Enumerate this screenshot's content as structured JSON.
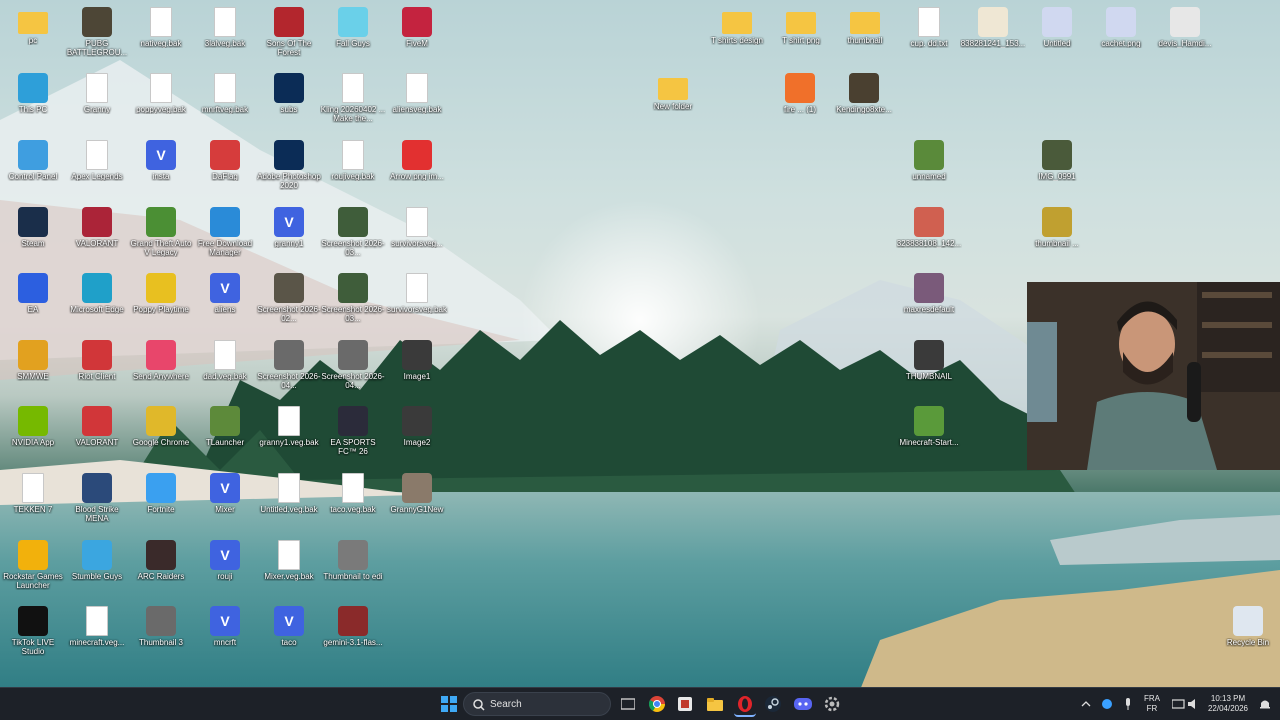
{
  "desktop": {
    "icons": [
      {
        "label": "pc",
        "kind": "folder",
        "color": "#f5c542"
      },
      {
        "label": "PUBG BATTLEGROU...",
        "kind": "app",
        "color": "#4d4636"
      },
      {
        "label": "nativeg.bak",
        "kind": "doc",
        "color": "#ffffff"
      },
      {
        "label": "3lalveg.bak",
        "kind": "doc",
        "color": "#ffffff"
      },
      {
        "label": "Sons Of The Forest",
        "kind": "app",
        "color": "#b3262d"
      },
      {
        "label": "Fall Guys",
        "kind": "app",
        "color": "#6ad0e9"
      },
      {
        "label": "FiveM",
        "kind": "app",
        "color": "#c4233f"
      },
      {
        "label": "This PC",
        "kind": "app",
        "color": "#2e9fd9"
      },
      {
        "label": "Granny",
        "kind": "doc",
        "color": "#ffffff"
      },
      {
        "label": "poppyveg.bak",
        "kind": "doc",
        "color": "#ffffff"
      },
      {
        "label": "mnrftveg.bak",
        "kind": "doc",
        "color": "#ffffff"
      },
      {
        "label": "subs",
        "kind": "app",
        "color": "#0b2c56"
      },
      {
        "label": "Kling 20260402 ... Make the...",
        "kind": "doc",
        "color": "#ffffff"
      },
      {
        "label": "aliensveg.bak",
        "kind": "doc",
        "color": "#ffffff"
      },
      {
        "label": "Control Panel",
        "kind": "app",
        "color": "#3f9ee0"
      },
      {
        "label": "Apex Legends",
        "kind": "doc",
        "color": "#ffffff"
      },
      {
        "label": "insta",
        "kind": "vveg",
        "color": "#3f63e0"
      },
      {
        "label": "DaFlag",
        "kind": "app",
        "color": "#d63c3c"
      },
      {
        "label": "Adobe Photoshop 2020",
        "kind": "app",
        "color": "#0b2c56"
      },
      {
        "label": "roujiveg.bak",
        "kind": "doc",
        "color": "#ffffff"
      },
      {
        "label": "Arrow png im...",
        "kind": "app",
        "color": "#e23030"
      },
      {
        "label": "Steam",
        "kind": "app",
        "color": "#1a2e4a"
      },
      {
        "label": "VALORANT",
        "kind": "app",
        "color": "#ab2438"
      },
      {
        "label": "Grand Theft Auto V Legacy",
        "kind": "app",
        "color": "#4b8f34"
      },
      {
        "label": "Free Download Manager",
        "kind": "app",
        "color": "#2a8bd8"
      },
      {
        "label": "granny1",
        "kind": "vveg",
        "color": "#3f63e0"
      },
      {
        "label": "Screenshot 2026-03...",
        "kind": "app",
        "color": "#3f5d3a"
      },
      {
        "label": "survivorsveg...",
        "kind": "doc",
        "color": "#ffffff"
      },
      {
        "label": "EA",
        "kind": "app",
        "color": "#2c5fe0"
      },
      {
        "label": "Microsoft Edge",
        "kind": "app",
        "color": "#1fa0c9"
      },
      {
        "label": "Poppy Playtime",
        "kind": "app",
        "color": "#e8c020"
      },
      {
        "label": "aliens",
        "kind": "vveg",
        "color": "#3f63e0"
      },
      {
        "label": "Screenshot 2026-02...",
        "kind": "app",
        "color": "#5a5548"
      },
      {
        "label": "Screenshot 2026-03...",
        "kind": "app",
        "color": "#3f5d3a"
      },
      {
        "label": "survivorsveg.bak",
        "kind": "doc",
        "color": "#ffffff"
      },
      {
        "label": "SMMWE",
        "kind": "app",
        "color": "#e2a11f"
      },
      {
        "label": "Riot Client",
        "kind": "app",
        "color": "#d13639"
      },
      {
        "label": "Send Anywhere",
        "kind": "app",
        "color": "#e8466b"
      },
      {
        "label": "dad.veg.bak",
        "kind": "doc",
        "color": "#ffffff"
      },
      {
        "label": "Screenshot 2026-04...",
        "kind": "app",
        "color": "#6a6a6a"
      },
      {
        "label": "Screenshot 2026-04...",
        "kind": "app",
        "color": "#6a6a6a"
      },
      {
        "label": "Image1",
        "kind": "app",
        "color": "#3a3a3a"
      },
      {
        "label": "NVIDIA App",
        "kind": "app",
        "color": "#76b900"
      },
      {
        "label": "VALORANT",
        "kind": "app",
        "color": "#d13639"
      },
      {
        "label": "Google Chrome",
        "kind": "app",
        "color": "#e0b82a"
      },
      {
        "label": "TLauncher",
        "kind": "app",
        "color": "#5d8a3a"
      },
      {
        "label": "granny1.veg.bak",
        "kind": "doc",
        "color": "#ffffff"
      },
      {
        "label": "EA SPORTS FC™ 26",
        "kind": "app",
        "color": "#2b2b3a"
      },
      {
        "label": "Image2",
        "kind": "app",
        "color": "#3a3a3a"
      },
      {
        "label": "TEKKEN 7",
        "kind": "doc",
        "color": "#ffffff"
      },
      {
        "label": "Blood Strike MENA",
        "kind": "app",
        "color": "#2b4a7a"
      },
      {
        "label": "Fortnite",
        "kind": "app",
        "color": "#3aa0f0"
      },
      {
        "label": "Mixer",
        "kind": "vveg",
        "color": "#3f63e0"
      },
      {
        "label": "Untitled.veg.bak",
        "kind": "doc",
        "color": "#ffffff"
      },
      {
        "label": "taco.veg.bak",
        "kind": "doc",
        "color": "#ffffff"
      },
      {
        "label": "GrannyG1New",
        "kind": "app",
        "color": "#8a7a6a"
      },
      {
        "label": "Rockstar Games Launcher",
        "kind": "app",
        "color": "#f2b10c"
      },
      {
        "label": "Stumble Guys",
        "kind": "app",
        "color": "#3ba6e0"
      },
      {
        "label": "ARC Raiders",
        "kind": "app",
        "color": "#3a2a2a"
      },
      {
        "label": "rouji",
        "kind": "vveg",
        "color": "#3f63e0"
      },
      {
        "label": "Mixer.veg.bak",
        "kind": "doc",
        "color": "#ffffff"
      },
      {
        "label": "Thumbnail to edi",
        "kind": "app",
        "color": "#7a7a7a"
      },
      {
        "label": "TikTok LIVE Studio",
        "kind": "app",
        "color": "#111111"
      },
      {
        "label": "minecraft.veg...",
        "kind": "doc",
        "color": "#ffffff"
      },
      {
        "label": "Thumbnail 3",
        "kind": "app",
        "color": "#6a6a6a"
      },
      {
        "label": "mncrft",
        "kind": "vveg",
        "color": "#3f63e0"
      },
      {
        "label": "taco",
        "kind": "vveg",
        "color": "#3f63e0"
      },
      {
        "label": "gemini-3.1-flas...",
        "kind": "app",
        "color": "#8a2a2a"
      },
      {
        "label": "New folder",
        "kind": "folder",
        "color": "#f5c542"
      },
      {
        "label": "fire ... (1)",
        "kind": "app",
        "color": "#f0702a"
      },
      {
        "label": "Kendingo8xte...",
        "kind": "app",
        "color": "#4a4030"
      },
      {
        "label": "T shirts design",
        "kind": "folder",
        "color": "#f5c542"
      },
      {
        "label": "T shirt png",
        "kind": "folder",
        "color": "#f5c542"
      },
      {
        "label": "thumbnail",
        "kind": "folder",
        "color": "#f5c542"
      },
      {
        "label": "cup. dd.txt",
        "kind": "doc",
        "color": "#ffffff"
      },
      {
        "label": "838281241_153...",
        "kind": "app",
        "color": "#efe7d4"
      },
      {
        "label": "Untitled",
        "kind": "app",
        "color": "#d0d8f0"
      },
      {
        "label": "cachet.png",
        "kind": "app",
        "color": "#d0d8f0"
      },
      {
        "label": "devis_Hamdi...",
        "kind": "app",
        "color": "#e7e7e7"
      },
      {
        "label": "unnamed",
        "kind": "app",
        "color": "#5a8a3a"
      },
      {
        "label": "IMG_0991",
        "kind": "app",
        "color": "#4a5a3a"
      },
      {
        "label": "323838108_142...",
        "kind": "app",
        "color": "#d06050"
      },
      {
        "label": "thumbnail ...",
        "kind": "app",
        "color": "#c0a030"
      },
      {
        "label": "maxresdefault",
        "kind": "app",
        "color": "#7a5a7a"
      },
      {
        "label": "THUMBNAIL",
        "kind": "app",
        "color": "#3a3a3a"
      },
      {
        "label": "Minecraft-Start...",
        "kind": "app",
        "color": "#5a9a3a"
      },
      {
        "label": "Recycle Bin",
        "kind": "app",
        "color": "#dfe7f0"
      }
    ]
  },
  "taskbar": {
    "search_label": "Search",
    "tray": {
      "language_line1": "FRA",
      "language_line2": "FR",
      "time": "10:13 PM",
      "date": "22/04/2026"
    },
    "pinned": [
      {
        "name": "start-button",
        "icon": "windows-icon"
      },
      {
        "name": "task-view",
        "icon": "task-view-icon"
      },
      {
        "name": "chrome",
        "icon": "chrome-icon"
      },
      {
        "name": "app-red",
        "icon": "app-icon"
      },
      {
        "name": "file-explorer",
        "icon": "folder-icon"
      },
      {
        "name": "opera",
        "icon": "opera-icon"
      },
      {
        "name": "steam",
        "icon": "steam-icon"
      },
      {
        "name": "discord",
        "icon": "discord-icon"
      },
      {
        "name": "settings",
        "icon": "gear-icon"
      }
    ]
  },
  "webcam": {
    "present": true
  }
}
